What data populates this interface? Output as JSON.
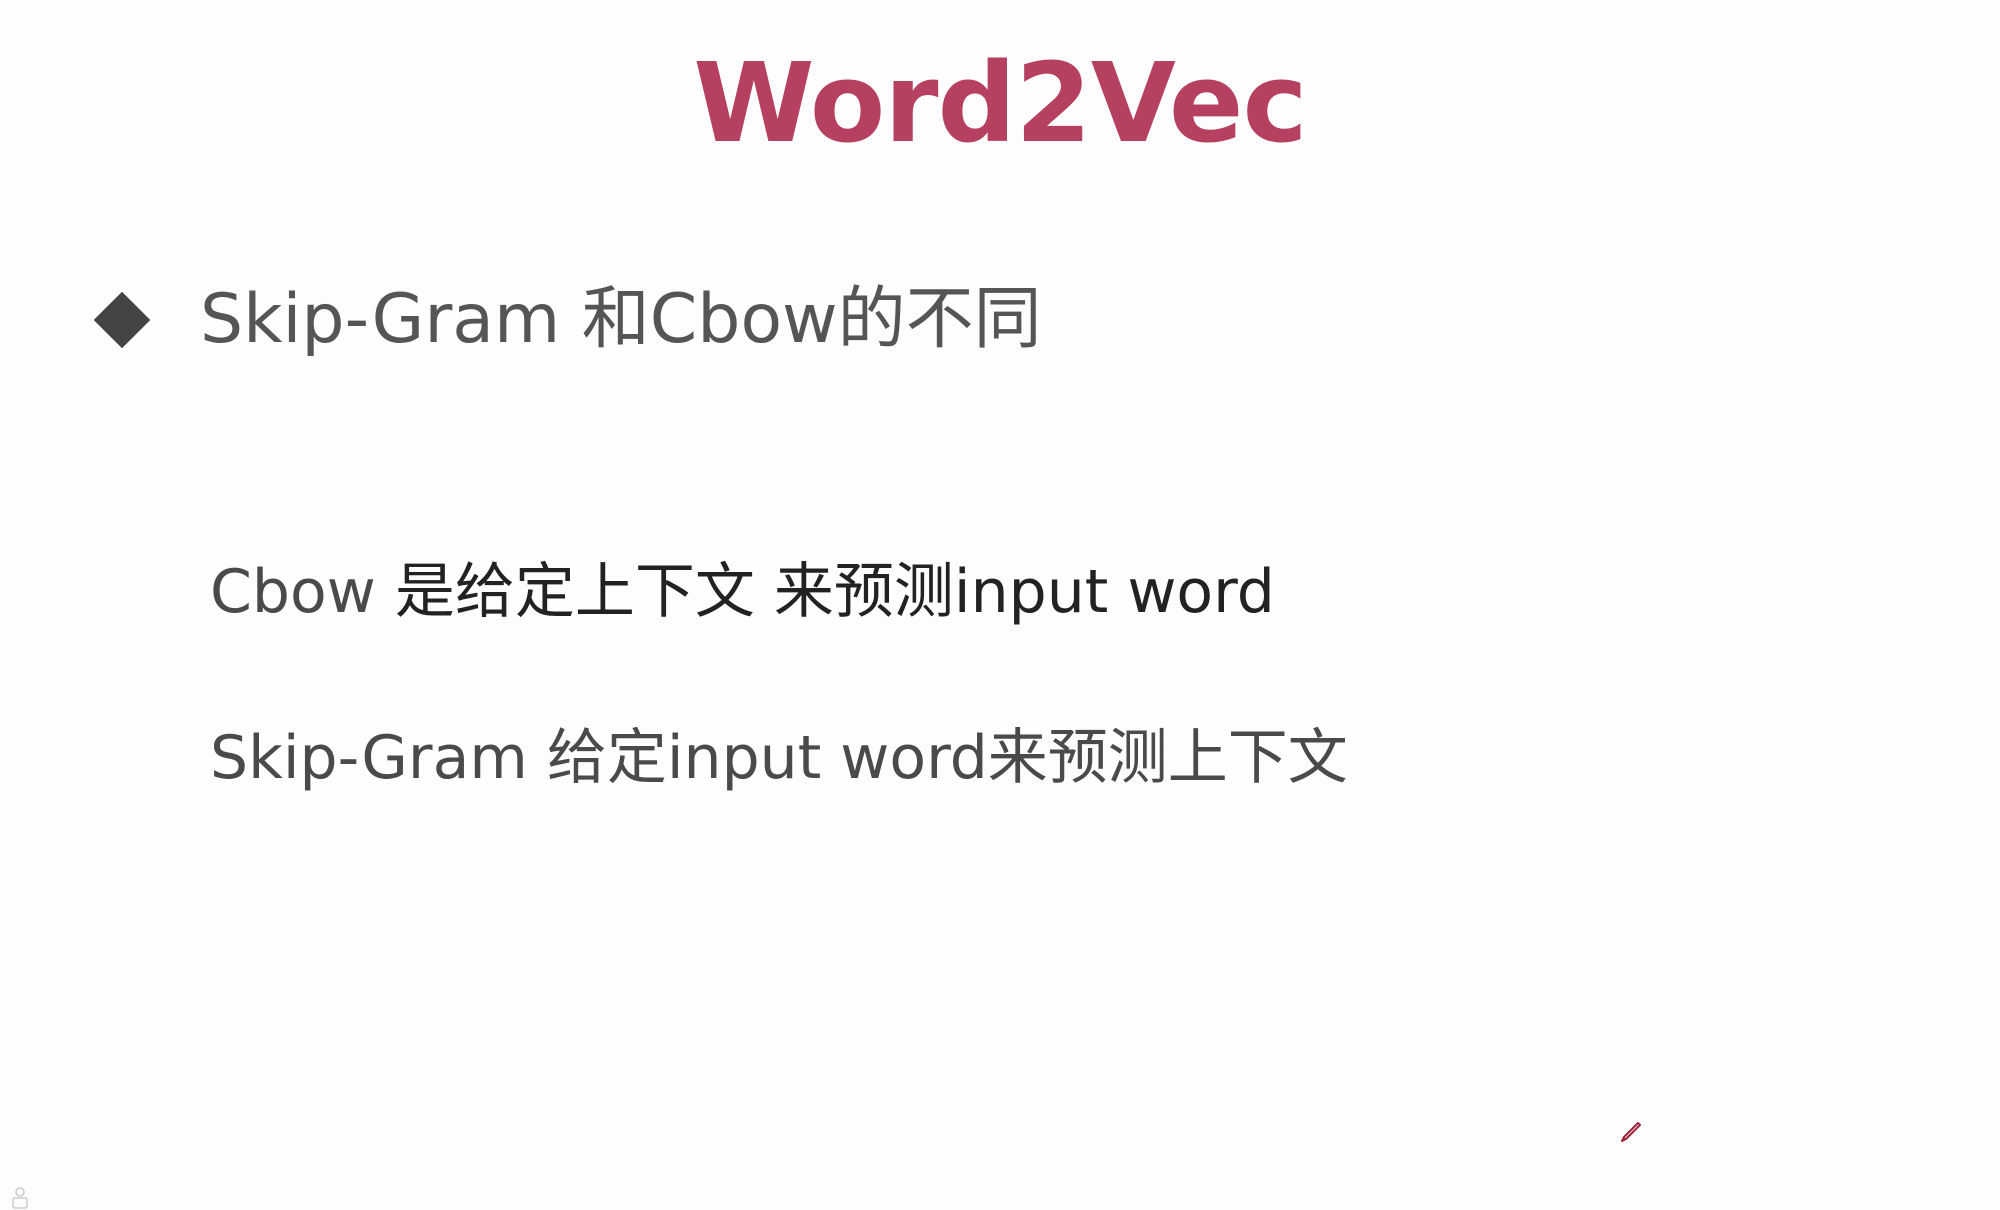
{
  "slide": {
    "title": "Word2Vec",
    "bullet": "Skip-Gram 和Cbow的不同",
    "lines": [
      {
        "term": "Cbow ",
        "desc": "是给定上下文 来预测input word"
      },
      {
        "term": "Skip-Gram  ",
        "desc": "给定input word来预测上下文"
      }
    ]
  },
  "colors": {
    "title": "#b5405f",
    "bullet_text": "#555555",
    "term_text": "#4a4a4a",
    "desc_text": "#222222",
    "diamond": "#444444",
    "pen": "#a0243e"
  },
  "icons": {
    "bullet": "diamond-icon",
    "pen": "pen-icon"
  }
}
